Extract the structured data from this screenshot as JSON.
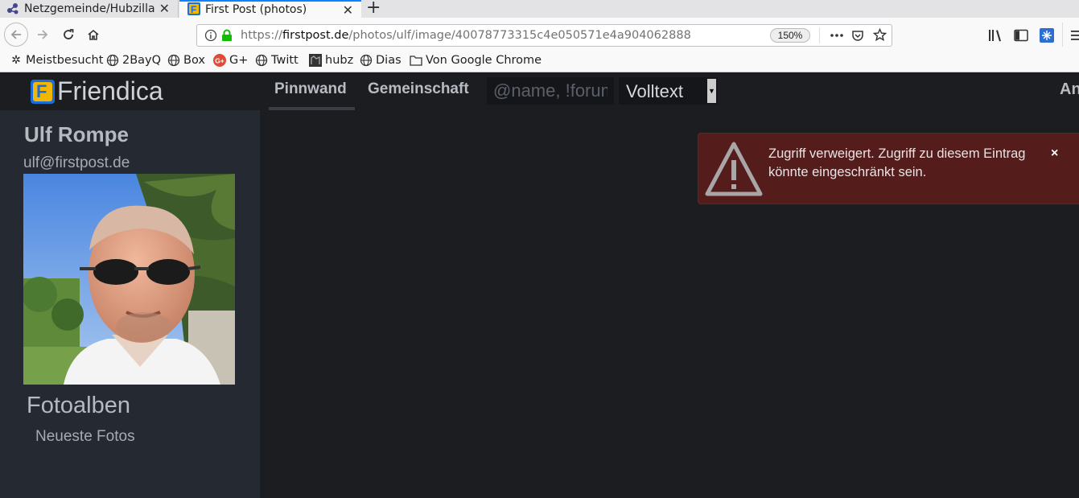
{
  "tabs": [
    {
      "title": "Netzgemeinde/Hubzilla",
      "active": false
    },
    {
      "title": "First Post (photos)",
      "active": true
    }
  ],
  "browser": {
    "url_scheme": "https://",
    "url_domain": "firstpost.de",
    "url_path": "/photos/ulf/image/40078773315c4e050571e4a904062888",
    "zoom": "150%",
    "newtab_glyph": "+",
    "close_glyph": "✕"
  },
  "bookmarks": [
    {
      "label": "Meistbesucht",
      "icon": "gear-icon"
    },
    {
      "label": "2BayQ",
      "icon": "globe-icon"
    },
    {
      "label": "Box",
      "icon": "globe-icon"
    },
    {
      "label": "G+",
      "icon": "google-plus-icon"
    },
    {
      "label": "Twitt",
      "icon": "globe-icon"
    },
    {
      "label": "hubz",
      "icon": "hubzilla-icon"
    },
    {
      "label": "Dias",
      "icon": "globe-icon"
    },
    {
      "label": "Von Google Chrome",
      "icon": "folder-icon"
    }
  ],
  "site": {
    "logo_text": "Friendica",
    "nav": {
      "pinnwand": "Pinnwand",
      "gemeinschaft": "Gemeinschaft",
      "right_truncated": "An"
    },
    "search": {
      "placeholder": "@name, !forum",
      "select_value": "Volltext"
    }
  },
  "profile": {
    "name": "Ulf Rompe",
    "address": "ulf@firstpost.de"
  },
  "albums": {
    "title": "Fotoalben",
    "recent": "Neueste Fotos"
  },
  "alert": {
    "message": "Zugriff verweigert. Zugriff zu diesem Eintrag könnte eingeschränkt sein.",
    "close_glyph": "×"
  },
  "colors": {
    "page_bg": "#1b1d21",
    "sidebar_bg": "#252932",
    "alert_bg": "#551c1c",
    "accent_blue": "#0a84ff"
  }
}
